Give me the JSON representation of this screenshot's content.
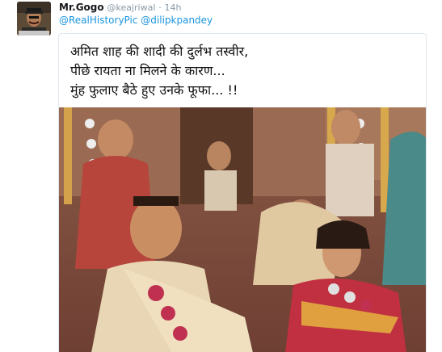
{
  "tweet": {
    "display_name": "Mr.Gogo",
    "handle": "@keajriwal",
    "separator": "·",
    "time": "14h",
    "reply_mentions": [
      "@RealHistoryPic",
      "@dilipkpandey"
    ],
    "caption_lines": [
      "अमित शाह की शादी की दुर्लभ तस्वीर,",
      "पीछे रायता ना मिलने के कारण...",
      "मुंह फुलाए बैठे हुए उनके फूफा... !!"
    ]
  },
  "colors": {
    "link": "#1b95e0",
    "name": "#14171a",
    "muted": "#8899a6",
    "border": "#e1e8ed"
  },
  "icons": {
    "avatar": "user-avatar",
    "photo": "wedding-photo"
  }
}
